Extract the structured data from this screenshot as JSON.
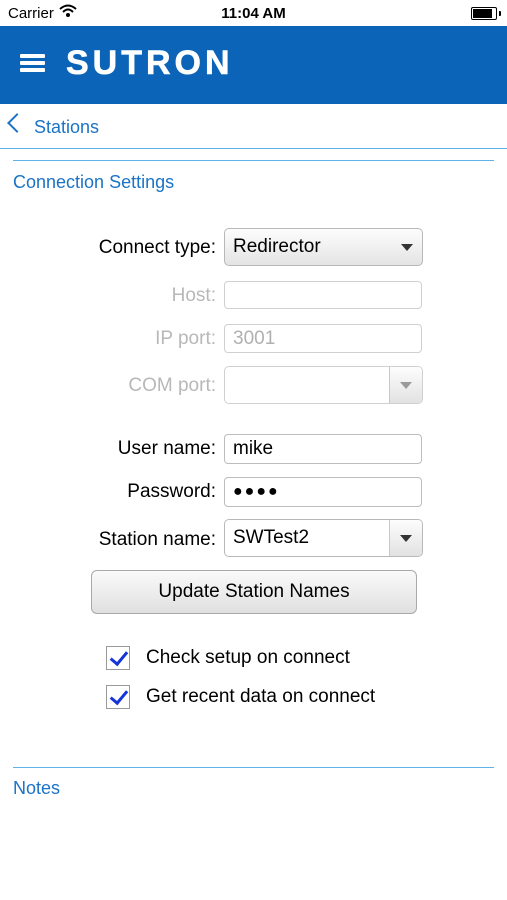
{
  "status_bar": {
    "carrier": "Carrier",
    "time": "11:04 AM",
    "battery_level": 0.95
  },
  "header": {
    "logo": "SUTRON",
    "menu_icon": "hamburger-menu-icon"
  },
  "nav": {
    "back_label": "Stations",
    "back_icon": "chevron-left-icon"
  },
  "connection": {
    "section_title": "Connection Settings",
    "connect_type": {
      "label": "Connect type:",
      "value": "Redirector"
    },
    "host": {
      "label": "Host:",
      "value": ""
    },
    "ip_port": {
      "label": "IP port:",
      "placeholder": "3001"
    },
    "com_port": {
      "label": "COM port:",
      "value": ""
    },
    "user_name": {
      "label": "User name:",
      "value": "mike"
    },
    "password": {
      "label": "Password:",
      "masked": "●●●●"
    },
    "station_name": {
      "label": "Station name:",
      "value": "SWTest2"
    },
    "update_button": "Update Station Names",
    "check_setup": {
      "label": "Check setup on connect",
      "checked": true
    },
    "recent_data": {
      "label": "Get recent data on connect",
      "checked": true
    }
  },
  "notes": {
    "section_title": "Notes"
  },
  "colors": {
    "header_bg": "#0b64b8",
    "accent": "#1a73c7",
    "divider": "#5fb3e6",
    "checkmark": "#1436d8"
  }
}
